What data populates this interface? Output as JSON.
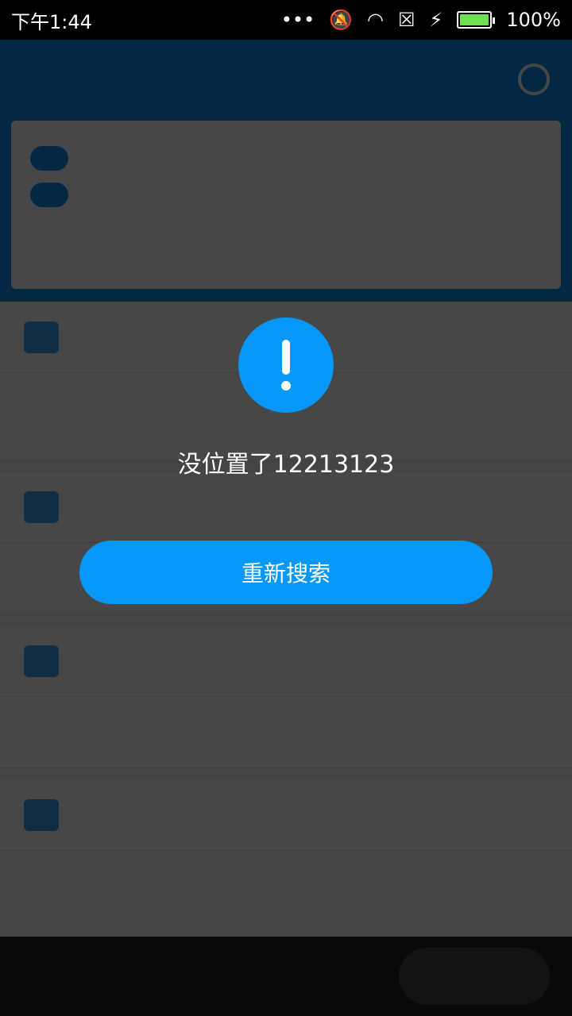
{
  "status_bar": {
    "time": "下午1:44",
    "battery_text": "100%",
    "icons": [
      "more-dots-icon",
      "mute-icon",
      "wifi-icon",
      "no-sim-icon",
      "charging-icon",
      "battery-icon"
    ]
  },
  "dialog": {
    "icon": "exclamation-icon",
    "message": "没位置了12213123",
    "button_label": "重新搜索"
  },
  "colors": {
    "accent": "#0598f8",
    "header_blue": "#0a90ef",
    "battery_green": "#6fe050"
  }
}
